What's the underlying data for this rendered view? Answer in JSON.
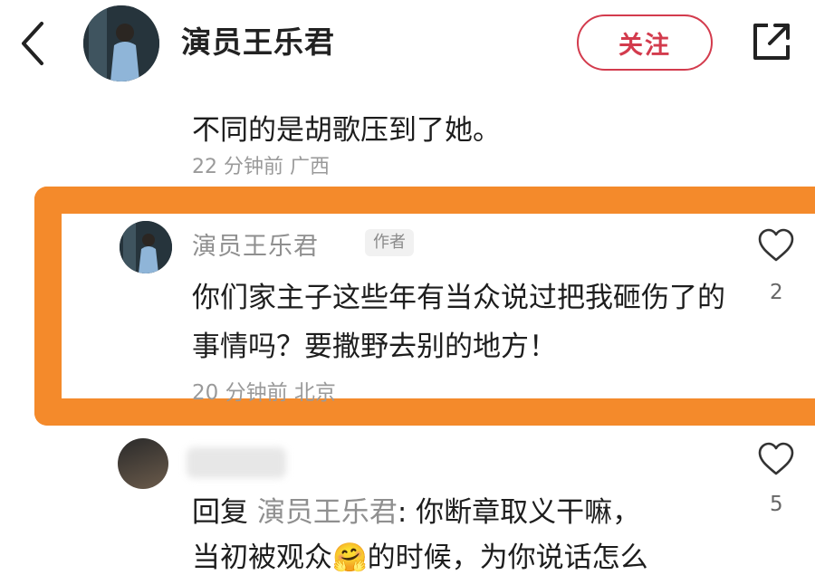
{
  "header": {
    "user_name": "演员王乐君",
    "follow_label": "关注"
  },
  "previous_comment": {
    "text": "不同的是胡歌压到了她。",
    "meta": "22 分钟前 广西"
  },
  "highlighted_comment": {
    "author": "演员王乐君",
    "badge": "作者",
    "text": "你们家主子这些年有当众说过把我砸伤了的事情吗？要撒野去别的地方！",
    "meta": "20 分钟前 北京",
    "likes": "2"
  },
  "reply": {
    "prefix": "回复 ",
    "target": "演员王乐君",
    "text_line1": ": 你断章取义干嘛，",
    "text_line2": "当初被观众🤗的时候，为你说话怎么",
    "likes": "5"
  },
  "colors": {
    "accent_red": "#d33b4d",
    "highlight_orange": "#f48a2b"
  },
  "icons": {
    "back": "chevron-left-icon",
    "share": "share-external-icon",
    "like": "heart-outline-icon"
  }
}
